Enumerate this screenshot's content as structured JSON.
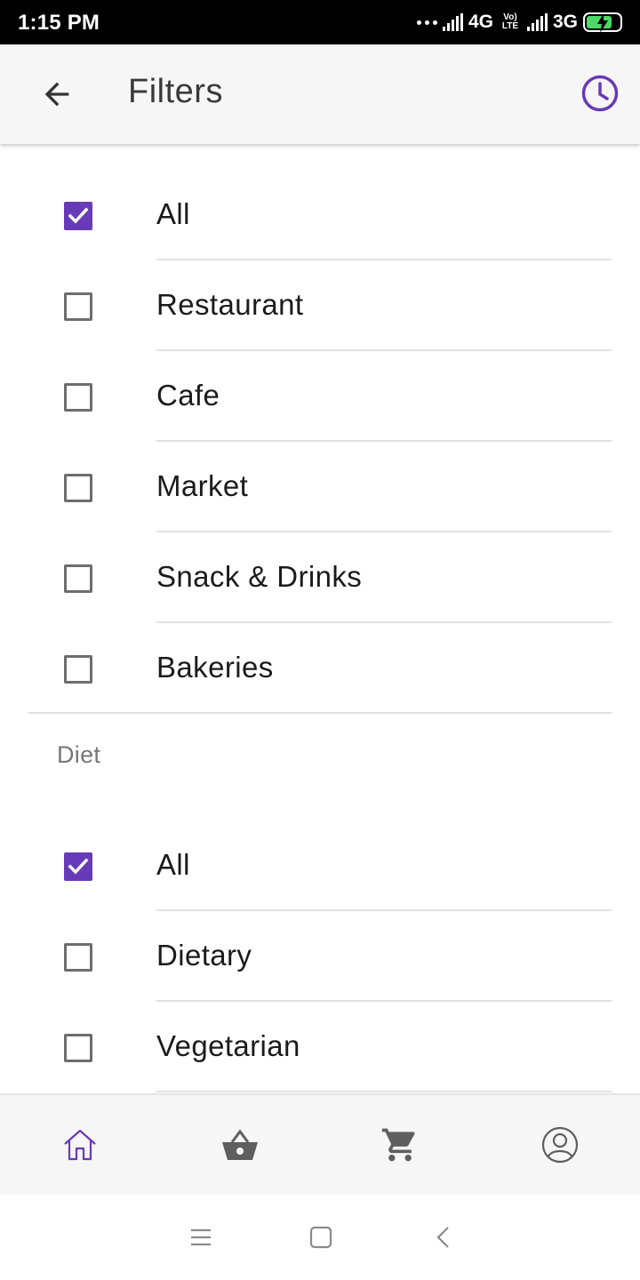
{
  "status_bar": {
    "time": "1:15 PM",
    "network_1": "4G",
    "network_2": "3G",
    "volte": "Vo) LTE"
  },
  "app_bar": {
    "title": "Filters",
    "back_icon": "arrow-back-icon",
    "history_icon": "clock-icon"
  },
  "place_filters": {
    "options": [
      {
        "label": "All",
        "checked": true
      },
      {
        "label": "Restaurant",
        "checked": false
      },
      {
        "label": "Cafe",
        "checked": false
      },
      {
        "label": "Market",
        "checked": false
      },
      {
        "label": "Snack & Drinks",
        "checked": false
      },
      {
        "label": "Bakeries",
        "checked": false
      }
    ]
  },
  "diet_filters": {
    "title": "Diet",
    "options": [
      {
        "label": "All",
        "checked": true
      },
      {
        "label": "Dietary",
        "checked": false
      },
      {
        "label": "Vegetarian",
        "checked": false
      }
    ]
  },
  "bottom_nav": {
    "items": [
      {
        "icon": "home-icon",
        "active": true
      },
      {
        "icon": "basket-icon",
        "active": false
      },
      {
        "icon": "cart-icon",
        "active": false
      },
      {
        "icon": "profile-icon",
        "active": false
      }
    ]
  },
  "colors": {
    "accent": "#673ab7",
    "icon_grey": "#5f5f5f",
    "divider": "#e2e2e2"
  }
}
